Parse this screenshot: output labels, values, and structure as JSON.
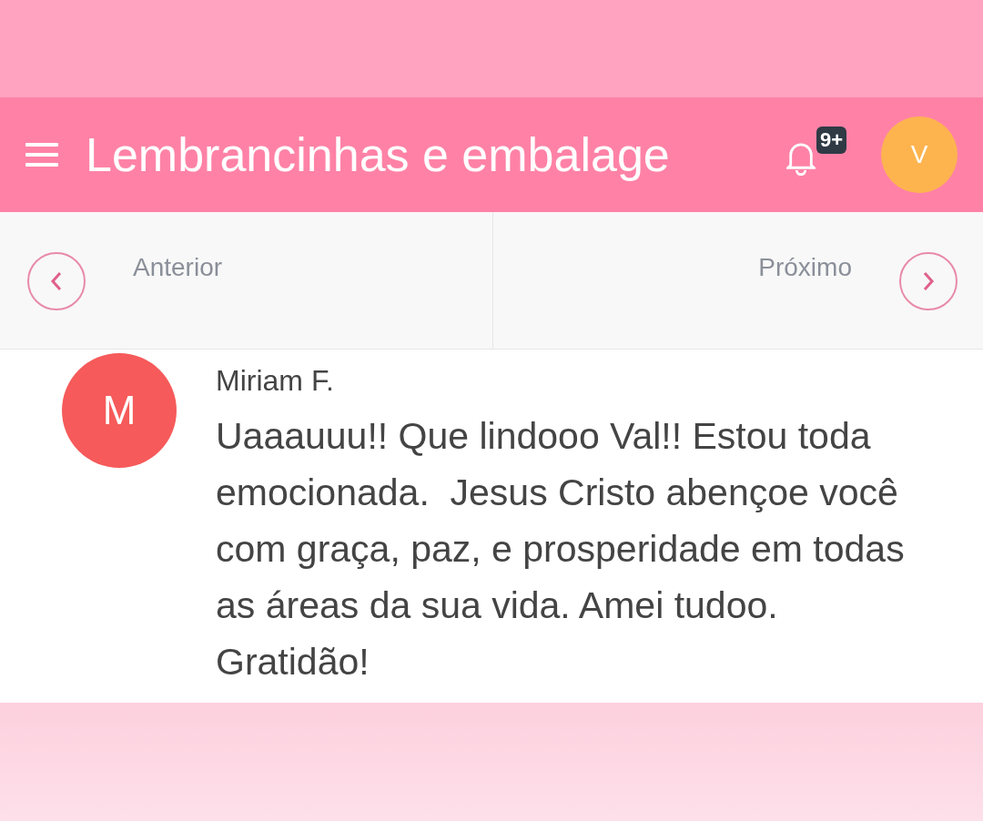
{
  "header": {
    "title": "Lembrancinhas e embalage",
    "notification_badge": "9+",
    "user_initial": "V"
  },
  "pager": {
    "previous": "Anterior",
    "next": "Próximo"
  },
  "comment": {
    "author_initial": "M",
    "author": "Miriam F.",
    "text": "Uaaauuu!! Que lindooo Val!! Estou toda emocionada.  Jesus Cristo abençoe você com graça, paz, e prosperidade em todas as áreas da sua vida. Amei tudoo. Gratidão!"
  }
}
